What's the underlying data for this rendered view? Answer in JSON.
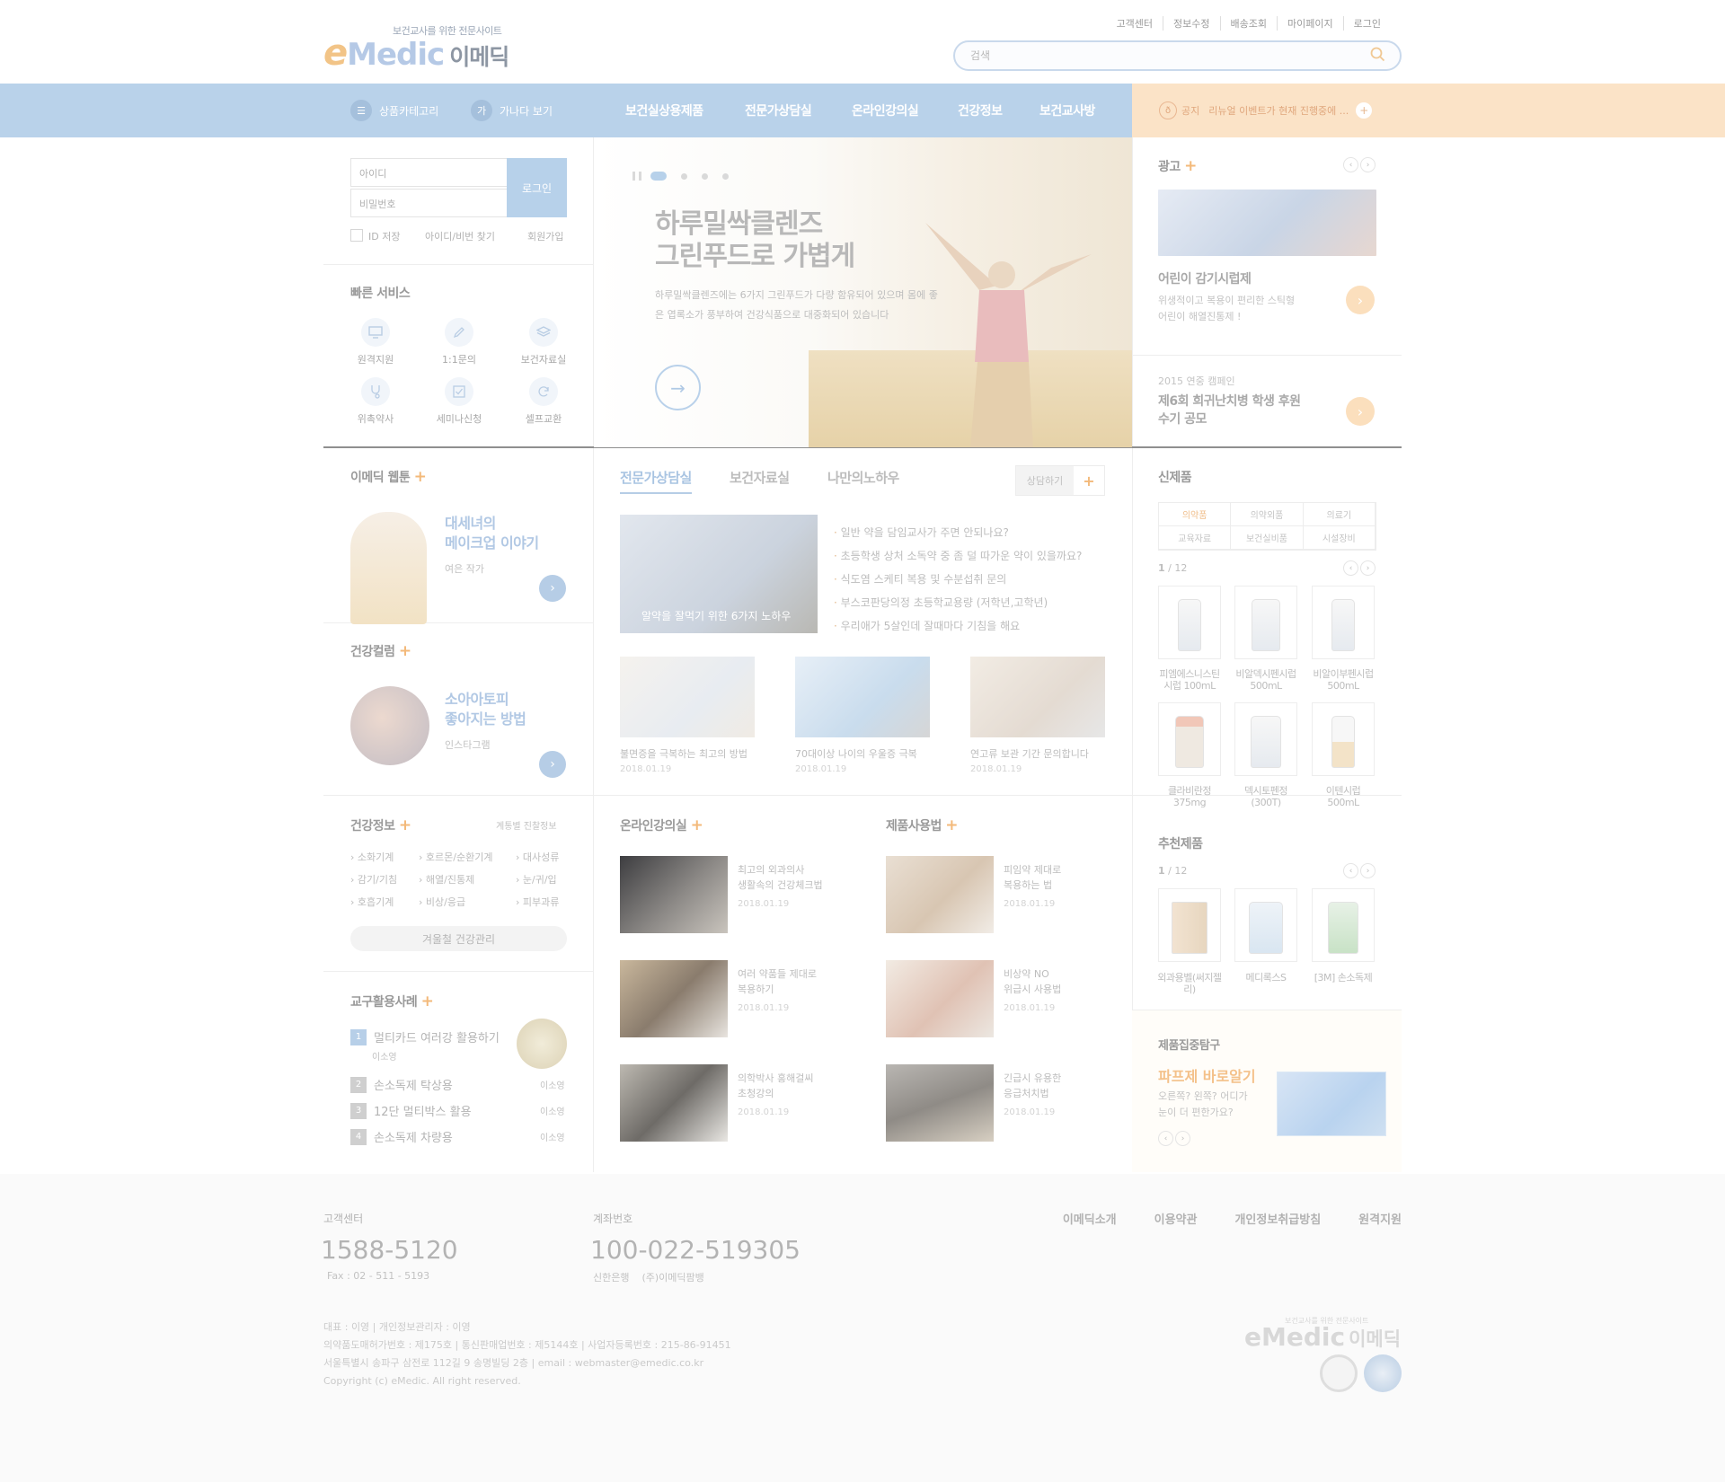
{
  "header": {
    "logo_sub": "보건교사를 위한 전문사이트",
    "logo_main": "Medic",
    "logo_e": "e",
    "logo_ko": "이메딕",
    "top_links": [
      "고객센터",
      "정보수정",
      "배송조회",
      "마이페이지",
      "로그인"
    ],
    "search_placeholder": "검색"
  },
  "nav": {
    "category_label": "상품카테고리",
    "ganada_icon": "가",
    "ganada_label": "가나다 보기",
    "menus": [
      "보건실상용제품",
      "전문가상담실",
      "온라인강의실",
      "건강정보",
      "보건교사방"
    ],
    "notice_label": "공지",
    "notice_text": "리뉴얼 이벤트가 현재 진행중에 ..."
  },
  "login": {
    "id_placeholder": "아이디",
    "pw_placeholder": "비밀번호",
    "button": "로그인",
    "save_id": "ID 저장",
    "find": "아이디/비번 찾기",
    "join": "회원가입"
  },
  "quick_service": {
    "title": "빠른 서비스",
    "items": [
      "원격지원",
      "1:1문의",
      "보건자료실",
      "위촉약사",
      "세미나신청",
      "셀프교환"
    ]
  },
  "hero": {
    "title_line1": "하루밀싹클렌즈",
    "title_line2": "그린푸드로 가볍게",
    "desc": "하루밀싹클렌즈에는 6가지 그린푸드가 다량 함유되어 있으며 몸에 좋은 엽록소가 풍부하여 건강식품으로 대중화되어 있습니다"
  },
  "ad": {
    "title": "광고",
    "cap1": "어린이 감기시럽제",
    "text1a": "위생적이고 복용이 편리한 스틱형",
    "text1b": "어린이 해열진통제 !",
    "campaign_label": "2015 연중 캠페인",
    "cap2a": "제6회 희귀난치병 학생 후원",
    "cap2b": "수기 공모"
  },
  "webtoon": {
    "title": "이메딕 웹툰",
    "line1": "대세녀의",
    "line2": "메이크업 이야기",
    "author": "여은 작가"
  },
  "column": {
    "title": "건강컬럼",
    "line1": "소아아토피",
    "line2": "좋아지는 방법",
    "author": "인스타그램"
  },
  "mid_tabs": {
    "tabs": [
      "전문가상담실",
      "보건자료실",
      "나만의노하우"
    ],
    "consult_label": "상담하기",
    "feature_caption": "알약을 잘먹기 위한 6가지 노하우",
    "questions": [
      "일반 약을 담임교사가 주면 안되나요?",
      "초등학생 상처 소독약 중 좀 덜 따가운 약이 있을까요?",
      "식도염 스케티 복용 및 수분섭취 문의",
      "부스코판당의정 초등학교용량 (저학년,고학년)",
      "우리애가 5살인데 잘때마다 기침을 해요"
    ],
    "thumbs": [
      {
        "caption": "불면증을 극복하는 최고의 방법",
        "date": "2018.01.19"
      },
      {
        "caption": "70대이상 나이의 우울증 극복",
        "date": "2018.01.19"
      },
      {
        "caption": "연고류 보관 기간 문의합니다",
        "date": "2018.01.19"
      }
    ]
  },
  "new_products": {
    "title": "신제품",
    "categories": [
      "의약품",
      "의약외품",
      "의료기",
      "교육자료",
      "보건실비품",
      "시설장비"
    ],
    "page": "1",
    "total": "/ 12",
    "items": [
      {
        "name1": "피엠에스니스틴",
        "name2": "시럽 100mL"
      },
      {
        "name1": "비알덱시펜시럽",
        "name2": "500mL"
      },
      {
        "name1": "비알이부펜시럽",
        "name2": "500mL"
      },
      {
        "name1": "클라비란정",
        "name2": "375mg"
      },
      {
        "name1": "덱시토펜정",
        "name2": "(300T)"
      },
      {
        "name1": "이텐시럽",
        "name2": "500mL"
      }
    ]
  },
  "recommended": {
    "title": "추천제품",
    "page": "1",
    "total": "/ 12",
    "items": [
      "외과용벨(써지젤리)",
      "메디록스S",
      "[3M] 손소독제"
    ]
  },
  "health_info": {
    "title": "건강정보",
    "sub": "계통별 진찰정보",
    "links": [
      "소화기계",
      "호르몬/순환기계",
      "대사성류",
      "감기/기침",
      "해열/진통제",
      "눈/귀/입",
      "호흡기계",
      "비상/응급",
      "피부과류"
    ],
    "winter": "겨울철 건강관리"
  },
  "tools": {
    "title": "교구활용사례",
    "items": [
      {
        "num": "1",
        "label": "멀티카드 여러강 활용하기",
        "sub": "이소영"
      },
      {
        "num": "2",
        "label": "손소독제 탁상용",
        "sub": "이소영"
      },
      {
        "num": "3",
        "label": "12단 멀티박스 활용",
        "sub": "이소영"
      },
      {
        "num": "4",
        "label": "손소독제 차량용",
        "sub": "이소영"
      }
    ]
  },
  "lectures": {
    "title": "온라인강의실",
    "items": [
      {
        "l1": "최고의 외과의사",
        "l2": "생활속의 건강체크법",
        "date": "2018.01.19"
      },
      {
        "l1": "여러 약품들 제대로",
        "l2": "복용하기",
        "date": "2018.01.19"
      },
      {
        "l1": "의학박사 홍해걸씨",
        "l2": "초청강의",
        "date": "2018.01.19"
      }
    ]
  },
  "usage": {
    "title": "제품사용법",
    "items": [
      {
        "l1": "피임약 제대로",
        "l2": "복용하는 법",
        "date": "2018.01.19"
      },
      {
        "l1": "비상약 NO",
        "l2": "위급시 사용법",
        "date": "2018.01.19"
      },
      {
        "l1": "긴급시 유용한",
        "l2": "응급처치법",
        "date": "2018.01.19"
      }
    ]
  },
  "focus": {
    "title": "제품집중탐구",
    "headline": "파프제 바로알기",
    "line1": "오른쪽? 왼쪽? 어디가",
    "line2": "눈이 더 편한가요?"
  },
  "footer": {
    "cs_label": "고객센터",
    "cs_phone": "1588-5120",
    "fax": "Fax : 02 - 511 - 5193",
    "account_label": "계좌번호",
    "account": "100-022-519305",
    "bank": "신한은행    (주)이메딕팜뱅",
    "links": [
      "이메딕소개",
      "이용약관",
      "개인정보취급방침",
      "원격지원"
    ],
    "info1": "대표 : 이영   |   개인정보관리자 : 이영",
    "info2": "의약품도매허가번호 : 제175호  |  통신판매업번호 : 제5144호   |   사업자등록번호 : 215-86-91451",
    "info3": "서울특별시 송파구 삼전로 112길 9 송명빌딩 2층   |   email : webmaster@emedic.co.kr",
    "copyright": "Copyright  (c)  eMedic. All right reserved.",
    "logo_sub": "보건교사를 위한 전문사이트",
    "logo_main": "eMedic",
    "logo_ko": "이메딕"
  }
}
